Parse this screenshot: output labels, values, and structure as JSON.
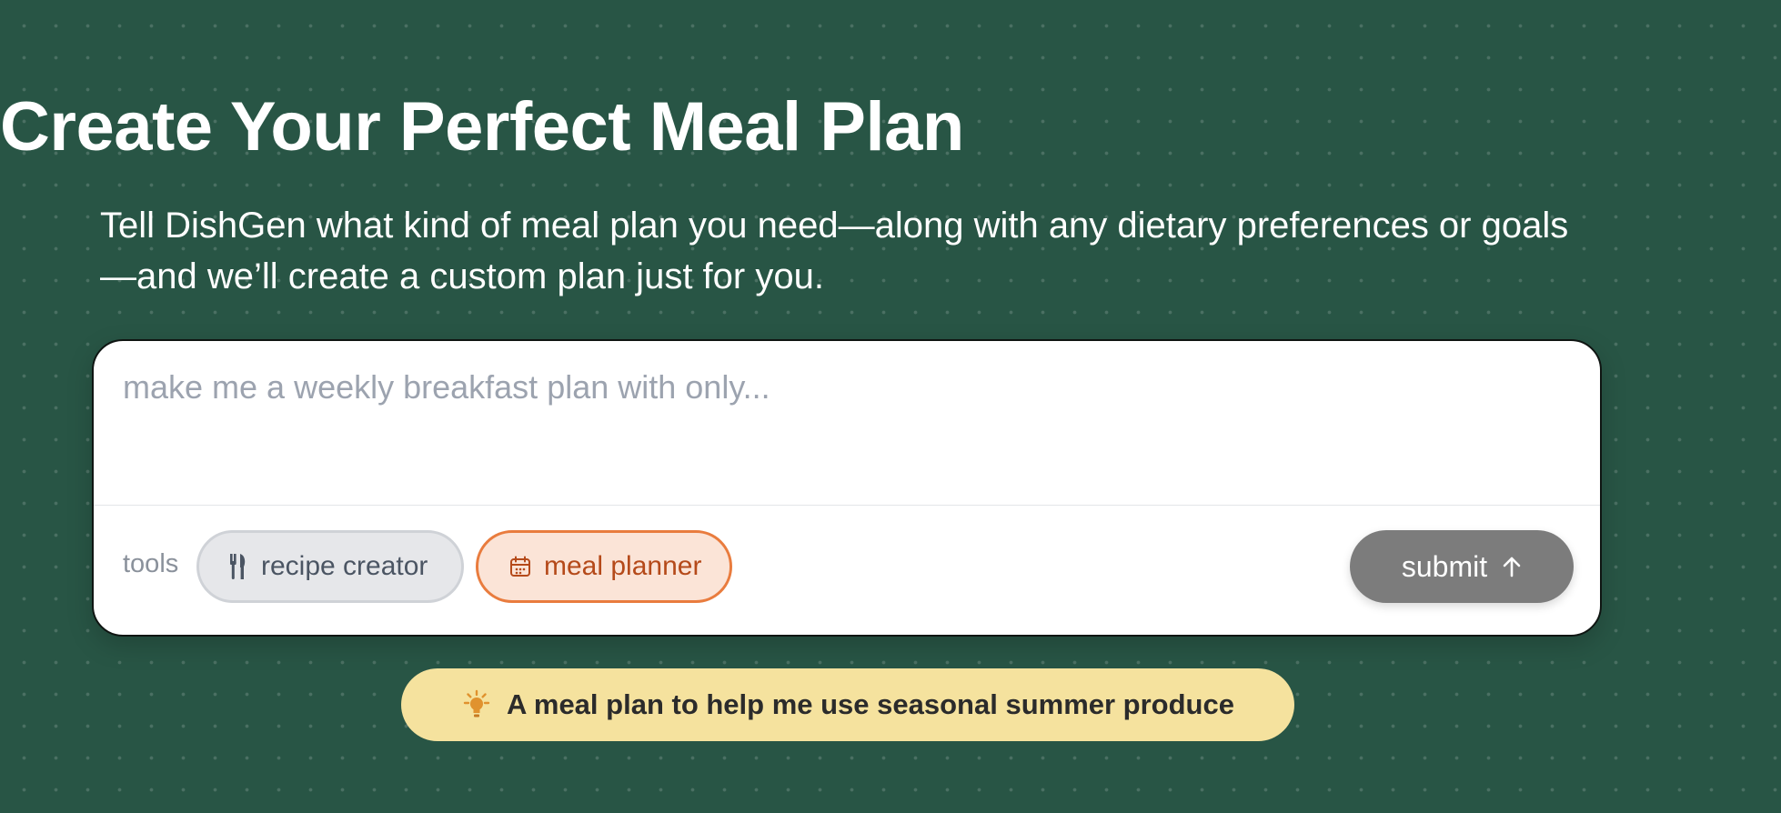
{
  "hero": {
    "title": "Create Your Perfect Meal Plan",
    "subtitle": "Tell DishGen what kind of meal plan you need—along with any dietary preferences or goals—and we’ll create a custom plan just for you."
  },
  "prompt": {
    "value": "",
    "placeholder": "make me a weekly breakfast plan with only..."
  },
  "tools": {
    "label": "tools",
    "items": [
      {
        "label": "recipe creator",
        "icon": "fork-knife-icon",
        "selected": false
      },
      {
        "label": "meal planner",
        "icon": "calendar-icon",
        "selected": true
      }
    ]
  },
  "submit": {
    "label": "submit",
    "icon": "arrow-up-icon"
  },
  "suggestion": {
    "label": "A meal plan to help me use seasonal summer produce",
    "icon": "lightbulb-icon"
  },
  "colors": {
    "background": "#285545",
    "selected_tool_accent": "#e97c3e",
    "suggestion_background": "#f5e29e",
    "submit_background": "#7c7c7c"
  }
}
